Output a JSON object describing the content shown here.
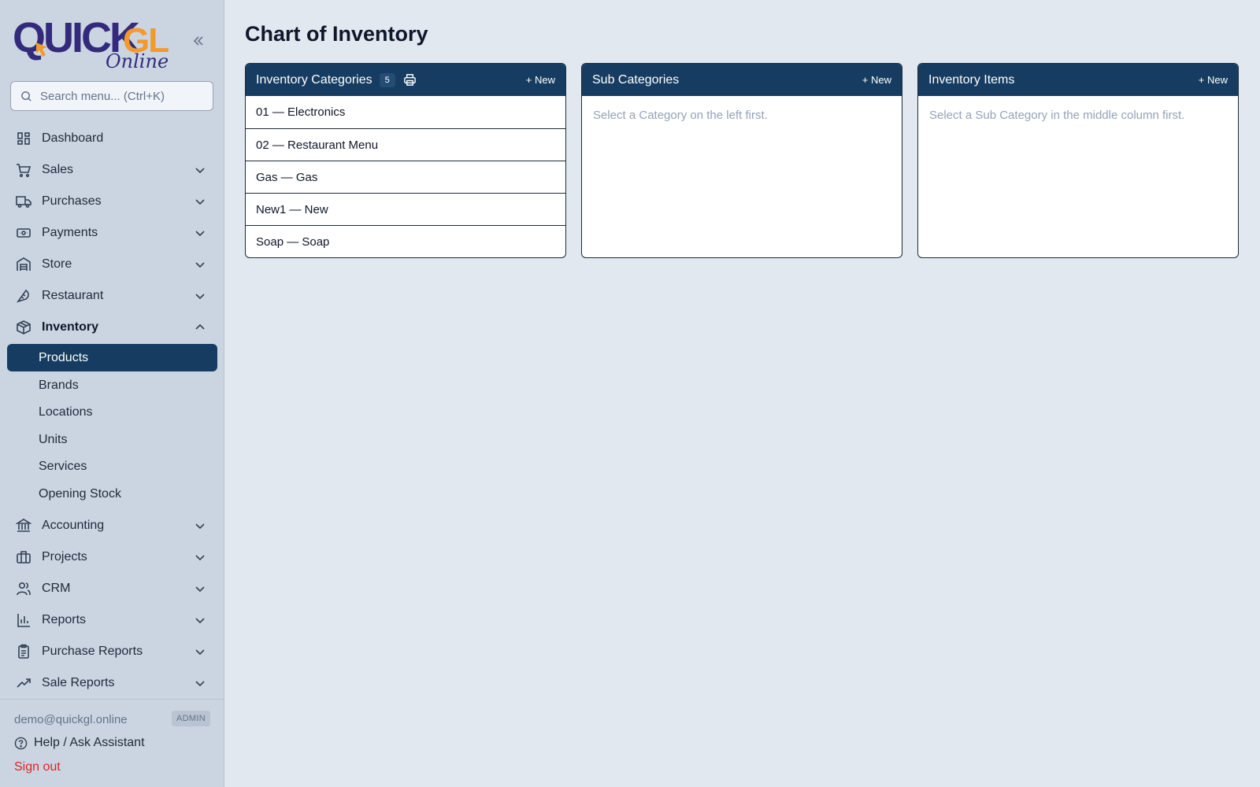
{
  "app": {
    "logo_text": "QuickGL",
    "logo_subtext": "Online"
  },
  "search": {
    "placeholder": "Search menu... (Ctrl+K)"
  },
  "nav": {
    "dashboard": "Dashboard",
    "sales": "Sales",
    "purchases": "Purchases",
    "payments": "Payments",
    "store": "Store",
    "restaurant": "Restaurant",
    "inventory": "Inventory",
    "inventory_sub": [
      "Products",
      "Brands",
      "Locations",
      "Units",
      "Services",
      "Opening Stock"
    ],
    "accounting": "Accounting",
    "projects": "Projects",
    "crm": "CRM",
    "reports": "Reports",
    "purchase_reports": "Purchase Reports",
    "sale_reports": "Sale Reports"
  },
  "footer": {
    "email": "demo@quickgl.online",
    "role": "ADMIN",
    "help": "Help / Ask Assistant",
    "signout": "Sign out"
  },
  "page": {
    "title": "Chart of Inventory"
  },
  "columns": {
    "categories": {
      "title": "Inventory Categories",
      "count": "5",
      "new_label": "+ New",
      "rows": [
        "01 — Electronics",
        "02 — Restaurant Menu",
        "Gas — Gas",
        "New1 — New",
        "Soap — Soap"
      ]
    },
    "subcategories": {
      "title": "Sub Categories",
      "new_label": "+ New",
      "empty_text": "Select a Category on the left first."
    },
    "items": {
      "title": "Inventory Items",
      "new_label": "+ New",
      "empty_text": "Select a Sub Category in the middle column first."
    }
  },
  "colors": {
    "brand_navy": "#163d61",
    "logo_purple": "#332a7c",
    "logo_orange": "#f29a2e",
    "sidebar_bg": "#cbd5e1",
    "page_bg": "#e2e8f0",
    "danger": "#dc2626"
  },
  "icons": {
    "dashboard": "grid-icon",
    "sales": "cart-icon",
    "purchases": "truck-icon",
    "payments": "banknote-icon",
    "store": "warehouse-icon",
    "restaurant": "utensils-icon",
    "inventory": "box-icon",
    "accounting": "bank-icon",
    "projects": "briefcase-icon",
    "crm": "users-icon",
    "reports": "bar-chart-icon",
    "purchase_reports": "clipboard-icon",
    "sale_reports": "trending-up-icon"
  }
}
